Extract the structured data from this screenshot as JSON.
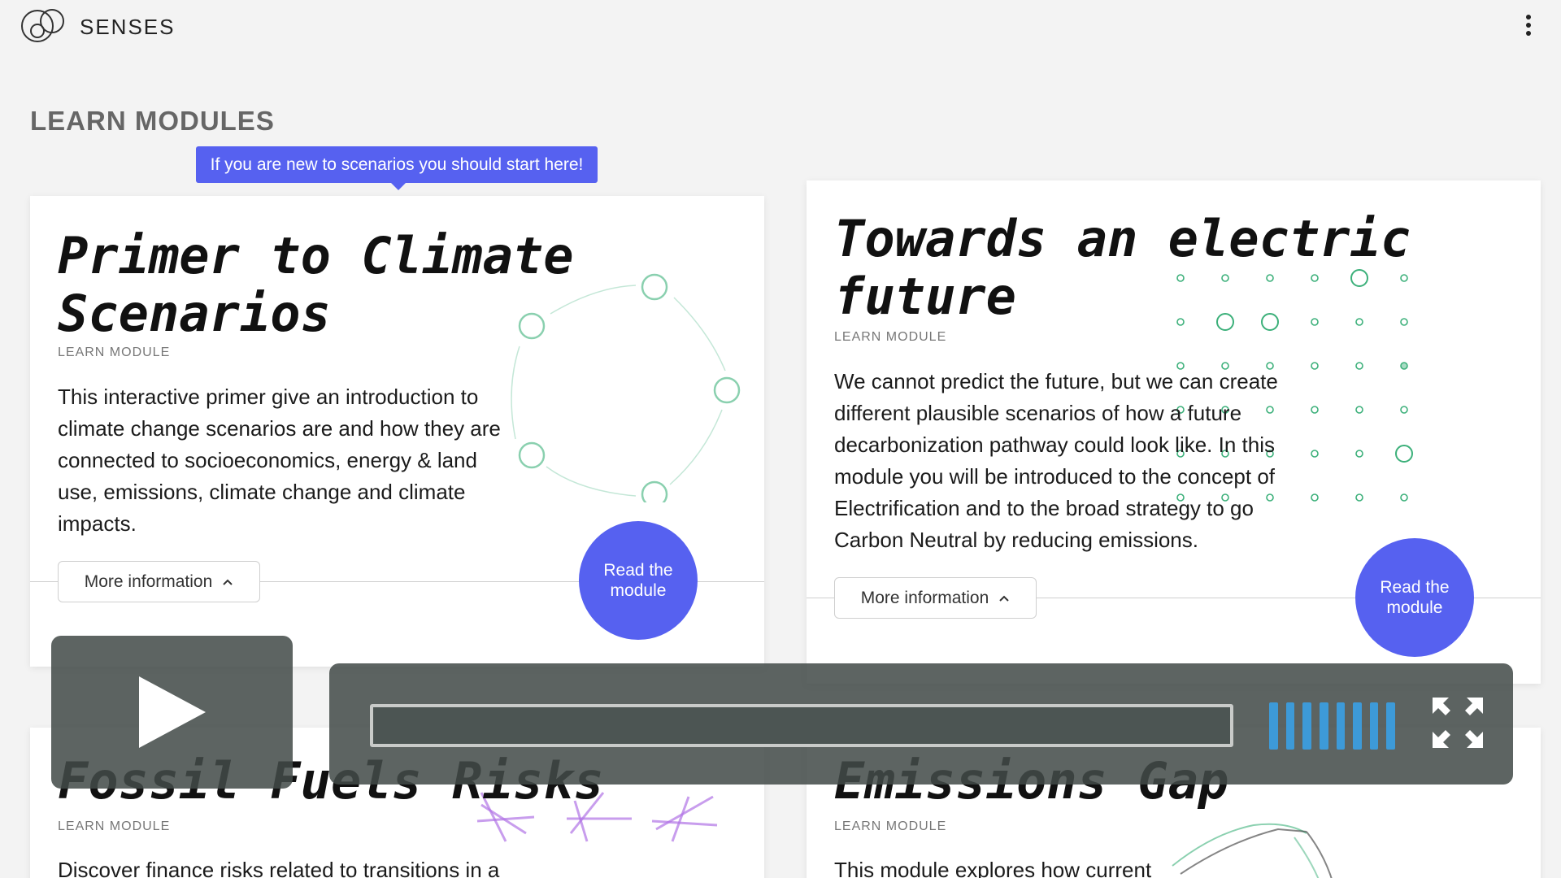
{
  "header": {
    "brand": "SENSES",
    "logo_icon": "overlapping-circles-logo",
    "menu_icon": "kebab-menu-icon"
  },
  "section_title": "LEARN MODULES",
  "tooltip": "If you are new to scenarios you should start here!",
  "modules": [
    {
      "title_line1": "Primer to Climate",
      "title_line2": "Scenarios",
      "kicker": "LEARN MODULE",
      "body": [
        "This interactive primer give an introduction to",
        "climate change scenarios are and how they are",
        "connected to socioeconomics, energy & land",
        "use, emissions, climate change and climate",
        "impacts."
      ],
      "more_label": "More information",
      "read_label_1": "Read the",
      "read_label_2": "module",
      "illustration": "cycle-circles-icon"
    },
    {
      "title_line1": "Towards an electric",
      "title_line2": "future",
      "kicker": "LEARN MODULE",
      "body": [
        "We cannot predict the future, but we can create",
        "different plausible scenarios of how a future",
        "decarbonization pathway could look like. In this",
        "module you will be introduced to the concept of",
        "Electrification and to the broad strategy to go",
        "Carbon Neutral by reducing emissions."
      ],
      "more_label": "More information",
      "read_label_1": "Read the",
      "read_label_2": "module",
      "illustration": "dot-grid-icon"
    },
    {
      "title_line1": "Fossil Fuels Risks",
      "kicker": "LEARN MODULE",
      "body": [
        "Discover finance risks related to transitions in a"
      ],
      "illustration": "crossed-lines-icon"
    },
    {
      "title_line1": "Emissions Gap",
      "kicker": "LEARN MODULE",
      "body": [
        "This module explores how current"
      ],
      "illustration": "pathway-lines-icon"
    }
  ],
  "player": {
    "play_icon": "play-icon",
    "fullscreen_icon": "fullscreen-icon",
    "volume_icon": "volume-bars-icon",
    "progress": 0,
    "volume_level": 1.0,
    "colors": {
      "panel": "#424a48",
      "volume": "#3d9ad8"
    }
  },
  "colors": {
    "accent": "#5661f0",
    "green": "#3cb07a",
    "purple": "#b074e6",
    "section_title": "#666666"
  }
}
